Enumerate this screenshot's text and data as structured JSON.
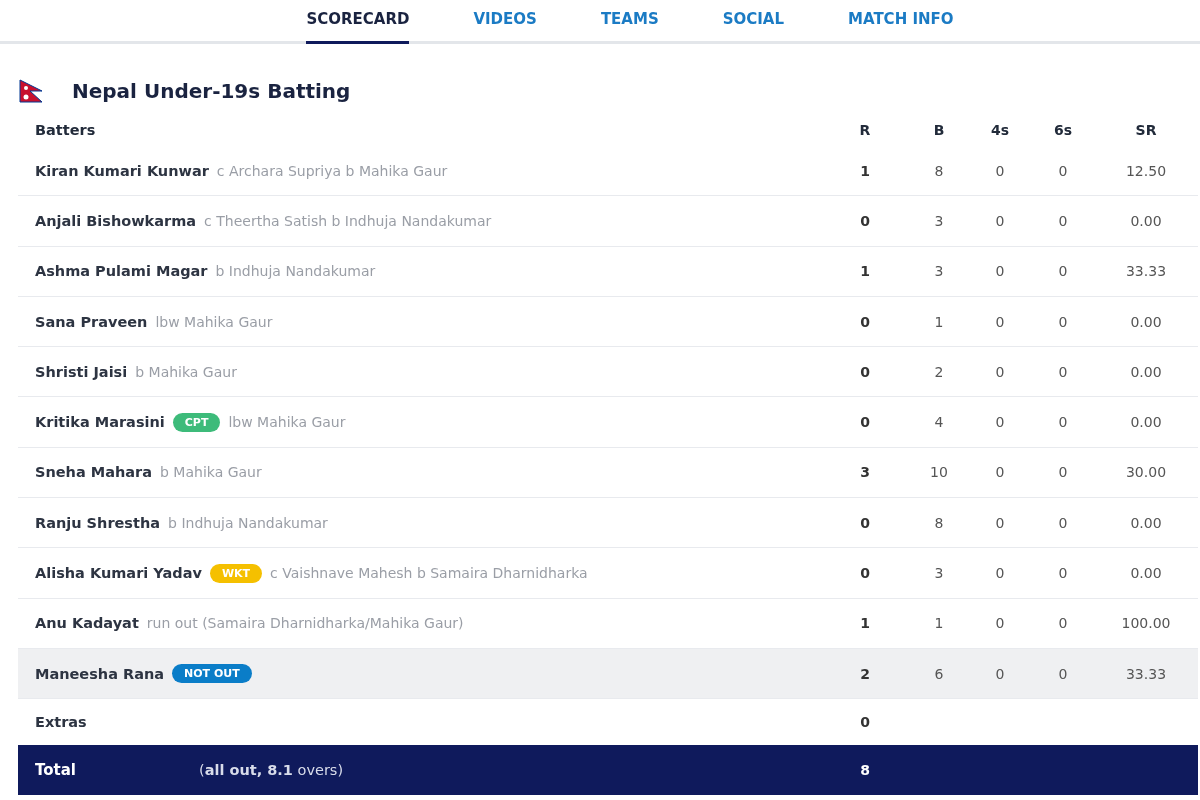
{
  "tabs": [
    {
      "label": "SCORECARD",
      "selected": true
    },
    {
      "label": "VIDEOS",
      "selected": false
    },
    {
      "label": "TEAMS",
      "selected": false
    },
    {
      "label": "SOCIAL",
      "selected": false
    },
    {
      "label": "MATCH INFO",
      "selected": false
    }
  ],
  "title": "Nepal Under-19s Batting",
  "columns": [
    "Batters",
    "R",
    "B",
    "4s",
    "6s",
    "SR"
  ],
  "rows": [
    {
      "name": "Kiran Kumari Kunwar",
      "dismissal": "c Archara Supriya b Mahika Gaur",
      "r": "1",
      "b": "8",
      "fours": "0",
      "sixes": "0",
      "sr": "12.50",
      "highlighted": false
    },
    {
      "name": "Anjali Bishowkarma",
      "dismissal": "c Theertha Satish b Indhuja Nandakumar",
      "r": "0",
      "b": "3",
      "fours": "0",
      "sixes": "0",
      "sr": "0.00",
      "highlighted": false
    },
    {
      "name": "Ashma Pulami Magar",
      "dismissal": "b Indhuja Nandakumar",
      "r": "1",
      "b": "3",
      "fours": "0",
      "sixes": "0",
      "sr": "33.33",
      "highlighted": false
    },
    {
      "name": "Sana Praveen",
      "dismissal": "lbw Mahika Gaur",
      "r": "0",
      "b": "1",
      "fours": "0",
      "sixes": "0",
      "sr": "0.00",
      "highlighted": false
    },
    {
      "name": "Shristi Jaisi",
      "dismissal": "b Mahika Gaur",
      "r": "0",
      "b": "2",
      "fours": "0",
      "sixes": "0",
      "sr": "0.00",
      "highlighted": false
    },
    {
      "name": "Kritika Marasini",
      "badge": {
        "label": "CPT",
        "color": "#3dbb7a"
      },
      "dismissal": "lbw Mahika Gaur",
      "r": "0",
      "b": "4",
      "fours": "0",
      "sixes": "0",
      "sr": "0.00",
      "highlighted": false
    },
    {
      "name": "Sneha Mahara",
      "dismissal": "b Mahika Gaur",
      "r": "3",
      "b": "10",
      "fours": "0",
      "sixes": "0",
      "sr": "30.00",
      "highlighted": false
    },
    {
      "name": "Ranju Shrestha",
      "dismissal": "b Indhuja Nandakumar",
      "r": "0",
      "b": "8",
      "fours": "0",
      "sixes": "0",
      "sr": "0.00",
      "highlighted": false
    },
    {
      "name": "Alisha Kumari Yadav",
      "badge": {
        "label": "WKT",
        "color": "#f5c000"
      },
      "dismissal": "c Vaishnave Mahesh b Samaira Dharnidharka",
      "r": "0",
      "b": "3",
      "fours": "0",
      "sixes": "0",
      "sr": "0.00",
      "highlighted": false
    },
    {
      "name": "Anu Kadayat",
      "dismissal": "run out (Samaira Dharnidharka/Mahika Gaur)",
      "r": "1",
      "b": "1",
      "fours": "0",
      "sixes": "0",
      "sr": "100.00",
      "highlighted": false
    },
    {
      "name": "Maneesha Rana",
      "badge": {
        "label": "NOT OUT",
        "color": "#0a7dc8"
      },
      "r": "2",
      "b": "6",
      "fours": "0",
      "sixes": "0",
      "sr": "33.33",
      "highlighted": true
    }
  ],
  "extras": {
    "label": "Extras",
    "value": "0"
  },
  "total": {
    "label": "Total",
    "detail": "(**all out, 8.1** overs)",
    "value": "8"
  }
}
